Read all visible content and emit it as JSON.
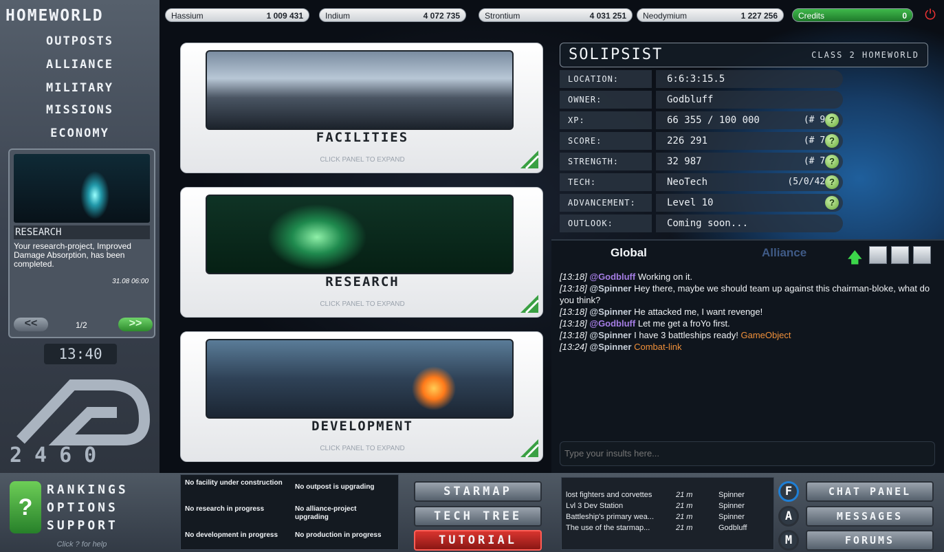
{
  "resources": [
    {
      "name": "Hassium",
      "value": "1 009 431"
    },
    {
      "name": "Indium",
      "value": "4 072 735"
    },
    {
      "name": "Strontium",
      "value": "4 031 251"
    },
    {
      "name": "Neodymium",
      "value": "1 227 256"
    },
    {
      "name": "Credits",
      "value": "0"
    }
  ],
  "nav": {
    "title": "HOMEWORLD",
    "items": [
      "OUTPOSTS",
      "ALLIANCE",
      "MILITARY",
      "MISSIONS",
      "ECONOMY"
    ]
  },
  "news": {
    "title": "RESEARCH",
    "text": "Your research-project, Improved Damage Absorption, has been completed.",
    "date": "31.08 06:00",
    "page": "1/2",
    "prev": "<<",
    "next": ">>"
  },
  "clock": "13:40",
  "logo_text": "2460",
  "help": {
    "icon": "?",
    "items": [
      "RANKINGS",
      "OPTIONS",
      "SUPPORT"
    ],
    "hint": "Click ? for help"
  },
  "panels": [
    {
      "title": "FACILITIES",
      "hint": "CLICK PANEL TO EXPAND"
    },
    {
      "title": "RESEARCH",
      "hint": "CLICK PANEL TO EXPAND"
    },
    {
      "title": "DEVELOPMENT",
      "hint": "CLICK PANEL TO EXPAND"
    }
  ],
  "planet": {
    "name": "SOLIPSIST",
    "class": "CLASS 2 HOMEWORLD",
    "rows": [
      {
        "label": "LOCATION:",
        "value": "6:6:3:15.5",
        "rank": ""
      },
      {
        "label": "OWNER:",
        "value": "Godbluff",
        "rank": ""
      },
      {
        "label": "XP:",
        "value": "66 355 / 100 000",
        "rank": "(# 9)"
      },
      {
        "label": "SCORE:",
        "value": "226 291",
        "rank": "(# 7)"
      },
      {
        "label": "STRENGTH:",
        "value": "32 987",
        "rank": "(# 7)"
      },
      {
        "label": "TECH:",
        "value": "NeoTech",
        "rank": "(5/0/42)"
      },
      {
        "label": "ADVANCEMENT:",
        "value": "Level 10",
        "rank": ""
      },
      {
        "label": "OUTLOOK:",
        "value": "Coming soon...",
        "rank": ""
      }
    ]
  },
  "chat": {
    "tab_global": "Global",
    "tab_alliance": "Alliance",
    "messages": [
      {
        "time": "[13:18]",
        "user": "@Godbluff",
        "text": "Working on it.",
        "link": ""
      },
      {
        "time": "[13:18]",
        "user": "@Spinner",
        "text": "Hey there, maybe we should team up against this chairman-bloke, what do you think?",
        "link": ""
      },
      {
        "time": "[13:18]",
        "user": "@Spinner",
        "text": "He attacked me, I want revenge!",
        "link": ""
      },
      {
        "time": "[13:18]",
        "user": "@Godbluff",
        "text": "Let me get a froYo first.",
        "link": ""
      },
      {
        "time": "[13:18]",
        "user": "@Spinner",
        "text": "I have 3 battleships ready!",
        "link": "GameObject"
      },
      {
        "time": "[13:24]",
        "user": "@Spinner",
        "text": "",
        "link": "Combat-link"
      }
    ],
    "input_placeholder": "Type your insults here..."
  },
  "status": {
    "facility": "No facility under construction",
    "outpost": "No outpost is upgrading",
    "research": "No research in progress",
    "alliance": "No alliance-project upgrading",
    "development": "No development in progress",
    "production": "No production in progress"
  },
  "center_buttons": [
    "STARMAP",
    "TECH TREE",
    "TUTORIAL"
  ],
  "forum": [
    {
      "title": "lost fighters and corvettes",
      "age": "21 m",
      "author": "Spinner"
    },
    {
      "title": "Lvl 3 Dev Station",
      "age": "21 m",
      "author": "Spinner"
    },
    {
      "title": "Battleship's primary wea...",
      "age": "21 m",
      "author": "Spinner"
    },
    {
      "title": "The use of the starmap...",
      "age": "21 m",
      "author": "Godbluff"
    }
  ],
  "letters": [
    "F",
    "A",
    "M"
  ],
  "right_buttons": [
    "CHAT PANEL",
    "MESSAGES",
    "FORUMS"
  ]
}
